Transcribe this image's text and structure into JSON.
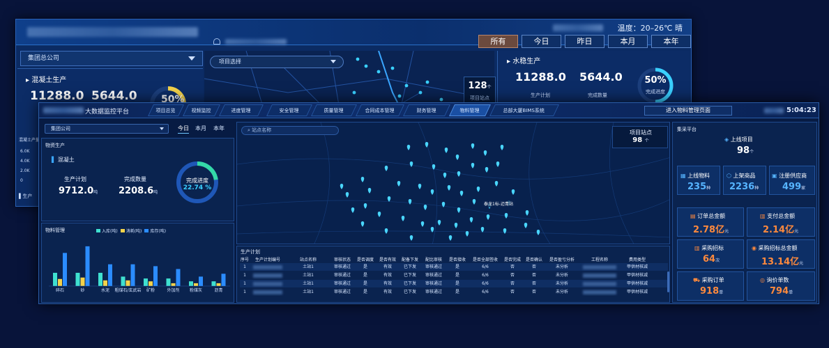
{
  "back": {
    "weather": "温度：20–26℃ 晴",
    "company": "集团总公司",
    "section": "混凝土生产",
    "value1": "11288.0",
    "value2": "5644.0",
    "gauge_pct": "50%",
    "tabs": [
      {
        "label": "所有",
        "active": true
      },
      {
        "label": "今日",
        "active": false
      },
      {
        "label": "昨日",
        "active": false
      },
      {
        "label": "本月",
        "active": false
      },
      {
        "label": "本年",
        "active": false
      }
    ],
    "project_select": "项目选择",
    "station_count": "128",
    "station_unit": "个",
    "station_label": "项目站点",
    "water": {
      "title": "水稳生产",
      "plan_value": "11288.0",
      "done_value": "5644.0",
      "plan_label": "生产计划",
      "done_label": "完成数量",
      "gauge_pct": "50%",
      "gauge_fraction": 0.5,
      "gauge_label": "完成进度"
    },
    "chart_ticks": [
      "6.0K",
      "4.0K",
      "2.0K",
      "0"
    ],
    "chart_title": "混凝土产量",
    "sub_title": "生产"
  },
  "front": {
    "title_suffix": "大数据监控平台",
    "nav": [
      "项目总览",
      "视频监控",
      "进度管理",
      "安全管理",
      "质量管理",
      "合同成本管理",
      "财务管理",
      "物料管理",
      "总部大厦BIMS系统"
    ],
    "nav_active_index": 7,
    "enter_button": "进入物料管理页面",
    "time": "5:04:23",
    "company": "集团公司",
    "date_tabs": [
      {
        "label": "今日",
        "active": true
      },
      {
        "label": "本月",
        "active": false
      },
      {
        "label": "本年",
        "active": false
      }
    ],
    "production": {
      "title": "物资生产",
      "subtitle": "混凝土",
      "plan_label": "生产计划",
      "plan_value": "9712.0",
      "plan_unit": "吨",
      "done_label": "完成数量",
      "done_value": "2208.6",
      "done_unit": "吨",
      "gauge_label": "完成进度",
      "gauge_pct": "22.74 %",
      "gauge_fraction": 0.2274
    },
    "materials": {
      "title": "物料管理",
      "legend": [
        "入库(吨)",
        "消耗(吨)",
        "库存(吨)"
      ],
      "colors": [
        "#3fe0d0",
        "#f3d24a",
        "#2b8cff"
      ],
      "categories": [
        "碎石",
        "砂",
        "水泥",
        "粗煤石/玄武岩",
        "矿粉",
        "外加剂",
        "粉煤灰",
        "沥青"
      ]
    },
    "map": {
      "search_placeholder": "站点名称",
      "station_label": "项目站点",
      "station_count": "98",
      "station_unit": "个",
      "tooltip": "泰龙1标-迈青站"
    },
    "plan": {
      "title": "生产计划",
      "headers": [
        "序号",
        "生产计划编号",
        "站点名称",
        "审核状态",
        "是否调度",
        "是否有效",
        "配备下发",
        "配比审核",
        "是否接收",
        "是否全部签收",
        "是否完成",
        "是否确认",
        "是否盈亏分析",
        "工程名称",
        "费用类型"
      ],
      "rows": [
        [
          "1",
          "",
          "土站1",
          "审核通过",
          "是",
          "有效",
          "已下发",
          "审核通过",
          "是",
          "6/6",
          "否",
          "否",
          "未分析",
          "",
          "甲供材核减"
        ],
        [
          "1",
          "",
          "土站1",
          "审核通过",
          "是",
          "有效",
          "已下发",
          "审核通过",
          "是",
          "6/6",
          "否",
          "否",
          "未分析",
          "",
          "甲供材核减"
        ],
        [
          "1",
          "",
          "土站1",
          "审核通过",
          "是",
          "有效",
          "已下发",
          "审核通过",
          "是",
          "6/6",
          "否",
          "否",
          "未分析",
          "",
          "甲供材核减"
        ],
        [
          "1",
          "",
          "土站1",
          "审核通过",
          "是",
          "有效",
          "已下发",
          "审核通过",
          "是",
          "6/6",
          "否",
          "否",
          "未分析",
          "",
          "甲供材核减"
        ]
      ]
    },
    "purchase": {
      "title": "集采平台",
      "online_project_label": "上线项目",
      "online_project_value": "98",
      "online_project_unit": "个",
      "online_material_label": "上线物料",
      "online_material_value": "235",
      "online_material_unit": "种",
      "goods_label": "上架商品",
      "goods_value": "2236",
      "goods_unit": "种",
      "supplier_label": "注册供应商",
      "supplier_value": "499",
      "supplier_unit": "家",
      "order_total_label": "订单总金额",
      "order_total_value": "2.78亿",
      "order_total_unit": "元",
      "pay_total_label": "支付总金额",
      "pay_total_value": "2.14亿",
      "pay_total_unit": "元",
      "bid_label": "采购招标",
      "bid_value": "64",
      "bid_unit": "次",
      "bid_total_label": "采购招标总金额",
      "bid_total_value": "13.14亿",
      "bid_total_unit": "元",
      "order_label": "采购订单",
      "order_value": "918",
      "order_unit": "单",
      "inquiry_label": "询价单数",
      "inquiry_value": "794",
      "inquiry_unit": "单"
    }
  }
}
